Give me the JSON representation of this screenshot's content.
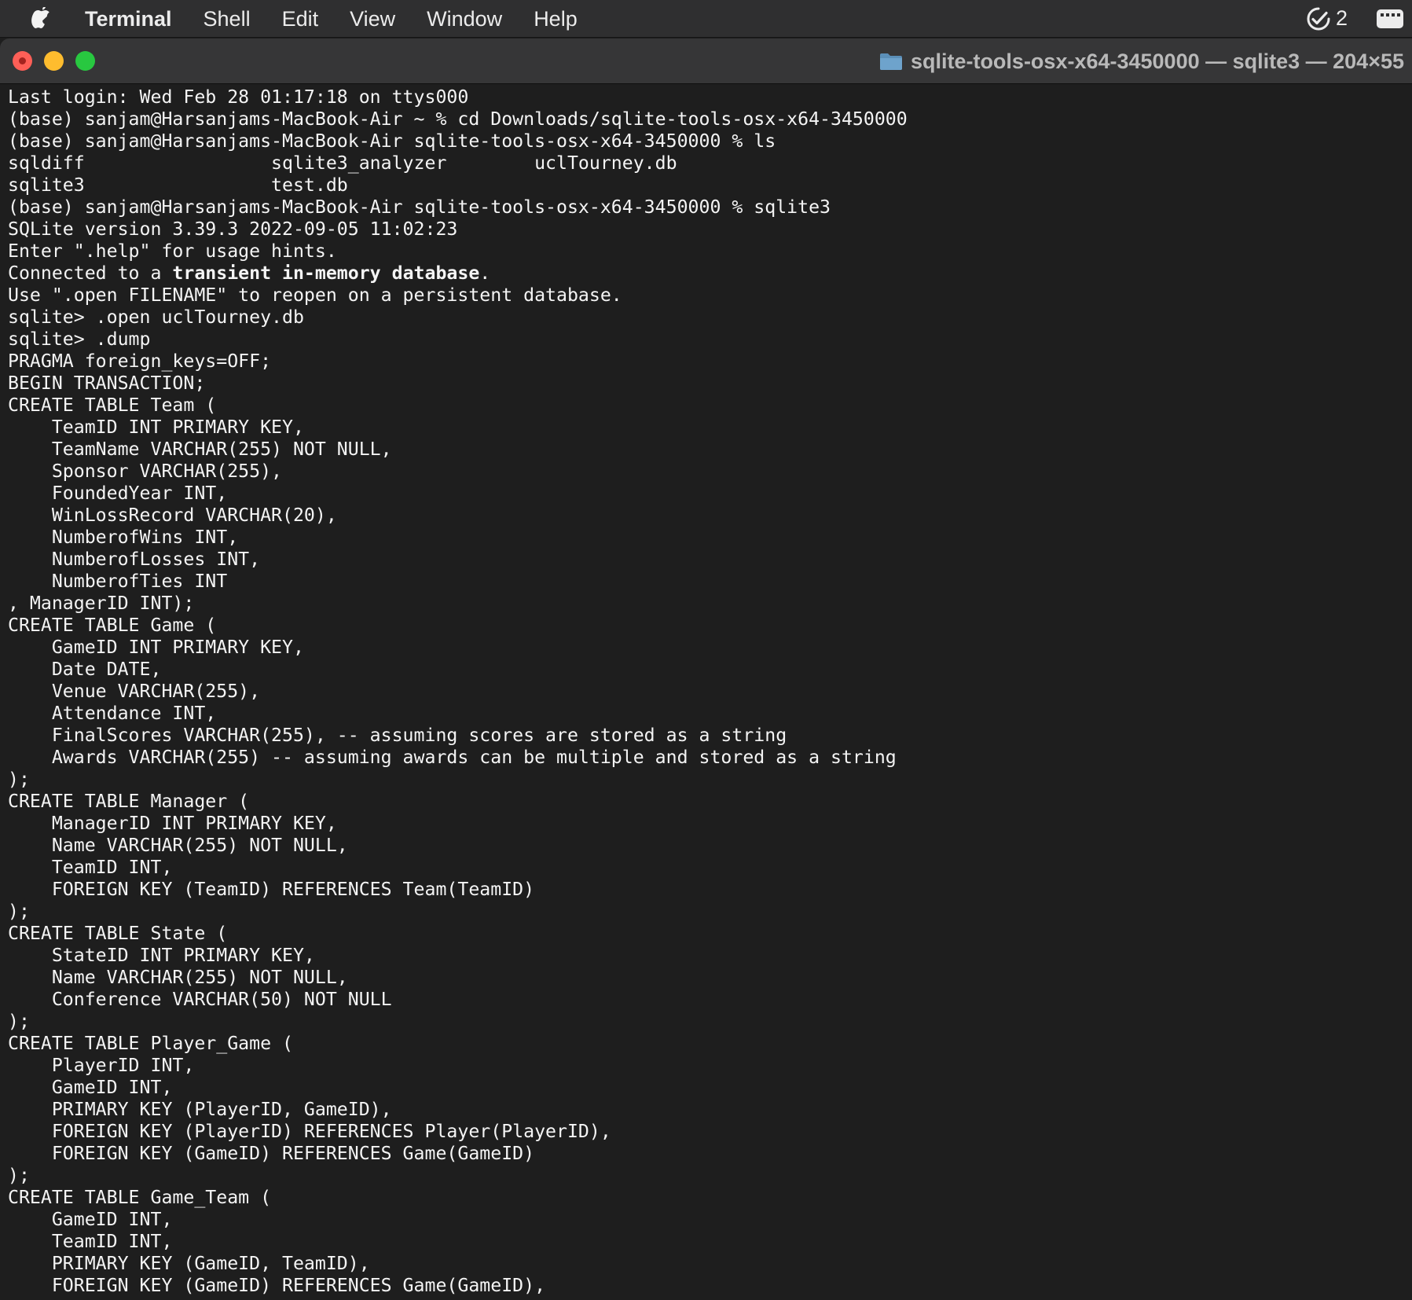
{
  "menubar": {
    "app_name": "Terminal",
    "items": [
      "Shell",
      "Edit",
      "View",
      "Window",
      "Help"
    ],
    "status_count": "2"
  },
  "window": {
    "title": "sqlite-tools-osx-x64-3450000 — sqlite3 — 204×55"
  },
  "terminal": {
    "lines": [
      {
        "text": "Last login: Wed Feb 28 01:17:18 on ttys000"
      },
      {
        "text": "(base) sanjam@Harsanjams-MacBook-Air ~ % cd Downloads/sqlite-tools-osx-x64-3450000",
        "mark": true
      },
      {
        "text": "(base) sanjam@Harsanjams-MacBook-Air sqlite-tools-osx-x64-3450000 % ls",
        "mark": true
      },
      {
        "text": "sqldiff                 sqlite3_analyzer        uclTourney.db"
      },
      {
        "text": "sqlite3                 test.db"
      },
      {
        "text": "(base) sanjam@Harsanjams-MacBook-Air sqlite-tools-osx-x64-3450000 % sqlite3",
        "mark": true
      },
      {
        "text": "SQLite version 3.39.3 2022-09-05 11:02:23"
      },
      {
        "text": "Enter \".help\" for usage hints."
      },
      {
        "parts": [
          {
            "t": "Connected to a "
          },
          {
            "t": "transient in-memory database",
            "b": true
          },
          {
            "t": "."
          }
        ]
      },
      {
        "text": "Use \".open FILENAME\" to reopen on a persistent database."
      },
      {
        "text": "sqlite> .open uclTourney.db",
        "mark": true
      },
      {
        "text": "sqlite> .dump",
        "mark": true
      },
      {
        "text": "PRAGMA foreign_keys=OFF;"
      },
      {
        "text": "BEGIN TRANSACTION;"
      },
      {
        "text": "CREATE TABLE Team ("
      },
      {
        "text": "    TeamID INT PRIMARY KEY,"
      },
      {
        "text": "    TeamName VARCHAR(255) NOT NULL,"
      },
      {
        "text": "    Sponsor VARCHAR(255),"
      },
      {
        "text": "    FoundedYear INT,"
      },
      {
        "text": "    WinLossRecord VARCHAR(20),"
      },
      {
        "text": "    NumberofWins INT,"
      },
      {
        "text": "    NumberofLosses INT,"
      },
      {
        "text": "    NumberofTies INT"
      },
      {
        "text": ", ManagerID INT);"
      },
      {
        "text": "CREATE TABLE Game ("
      },
      {
        "text": "    GameID INT PRIMARY KEY,"
      },
      {
        "text": "    Date DATE,"
      },
      {
        "text": "    Venue VARCHAR(255),"
      },
      {
        "text": "    Attendance INT,"
      },
      {
        "text": "    FinalScores VARCHAR(255), -- assuming scores are stored as a string"
      },
      {
        "text": "    Awards VARCHAR(255) -- assuming awards can be multiple and stored as a string"
      },
      {
        "text": ");"
      },
      {
        "text": "CREATE TABLE Manager ("
      },
      {
        "text": "    ManagerID INT PRIMARY KEY,"
      },
      {
        "text": "    Name VARCHAR(255) NOT NULL,"
      },
      {
        "text": "    TeamID INT,"
      },
      {
        "text": "    FOREIGN KEY (TeamID) REFERENCES Team(TeamID)"
      },
      {
        "text": ");"
      },
      {
        "text": "CREATE TABLE State ("
      },
      {
        "text": "    StateID INT PRIMARY KEY,"
      },
      {
        "text": "    Name VARCHAR(255) NOT NULL,"
      },
      {
        "text": "    Conference VARCHAR(50) NOT NULL"
      },
      {
        "text": ");"
      },
      {
        "text": "CREATE TABLE Player_Game ("
      },
      {
        "text": "    PlayerID INT,"
      },
      {
        "text": "    GameID INT,"
      },
      {
        "text": "    PRIMARY KEY (PlayerID, GameID),"
      },
      {
        "text": "    FOREIGN KEY (PlayerID) REFERENCES Player(PlayerID),"
      },
      {
        "text": "    FOREIGN KEY (GameID) REFERENCES Game(GameID)"
      },
      {
        "text": ");"
      },
      {
        "text": "CREATE TABLE Game_Team ("
      },
      {
        "text": "    GameID INT,"
      },
      {
        "text": "    TeamID INT,"
      },
      {
        "text": "    PRIMARY KEY (GameID, TeamID),"
      },
      {
        "text": "    FOREIGN KEY (GameID) REFERENCES Game(GameID),"
      }
    ]
  }
}
